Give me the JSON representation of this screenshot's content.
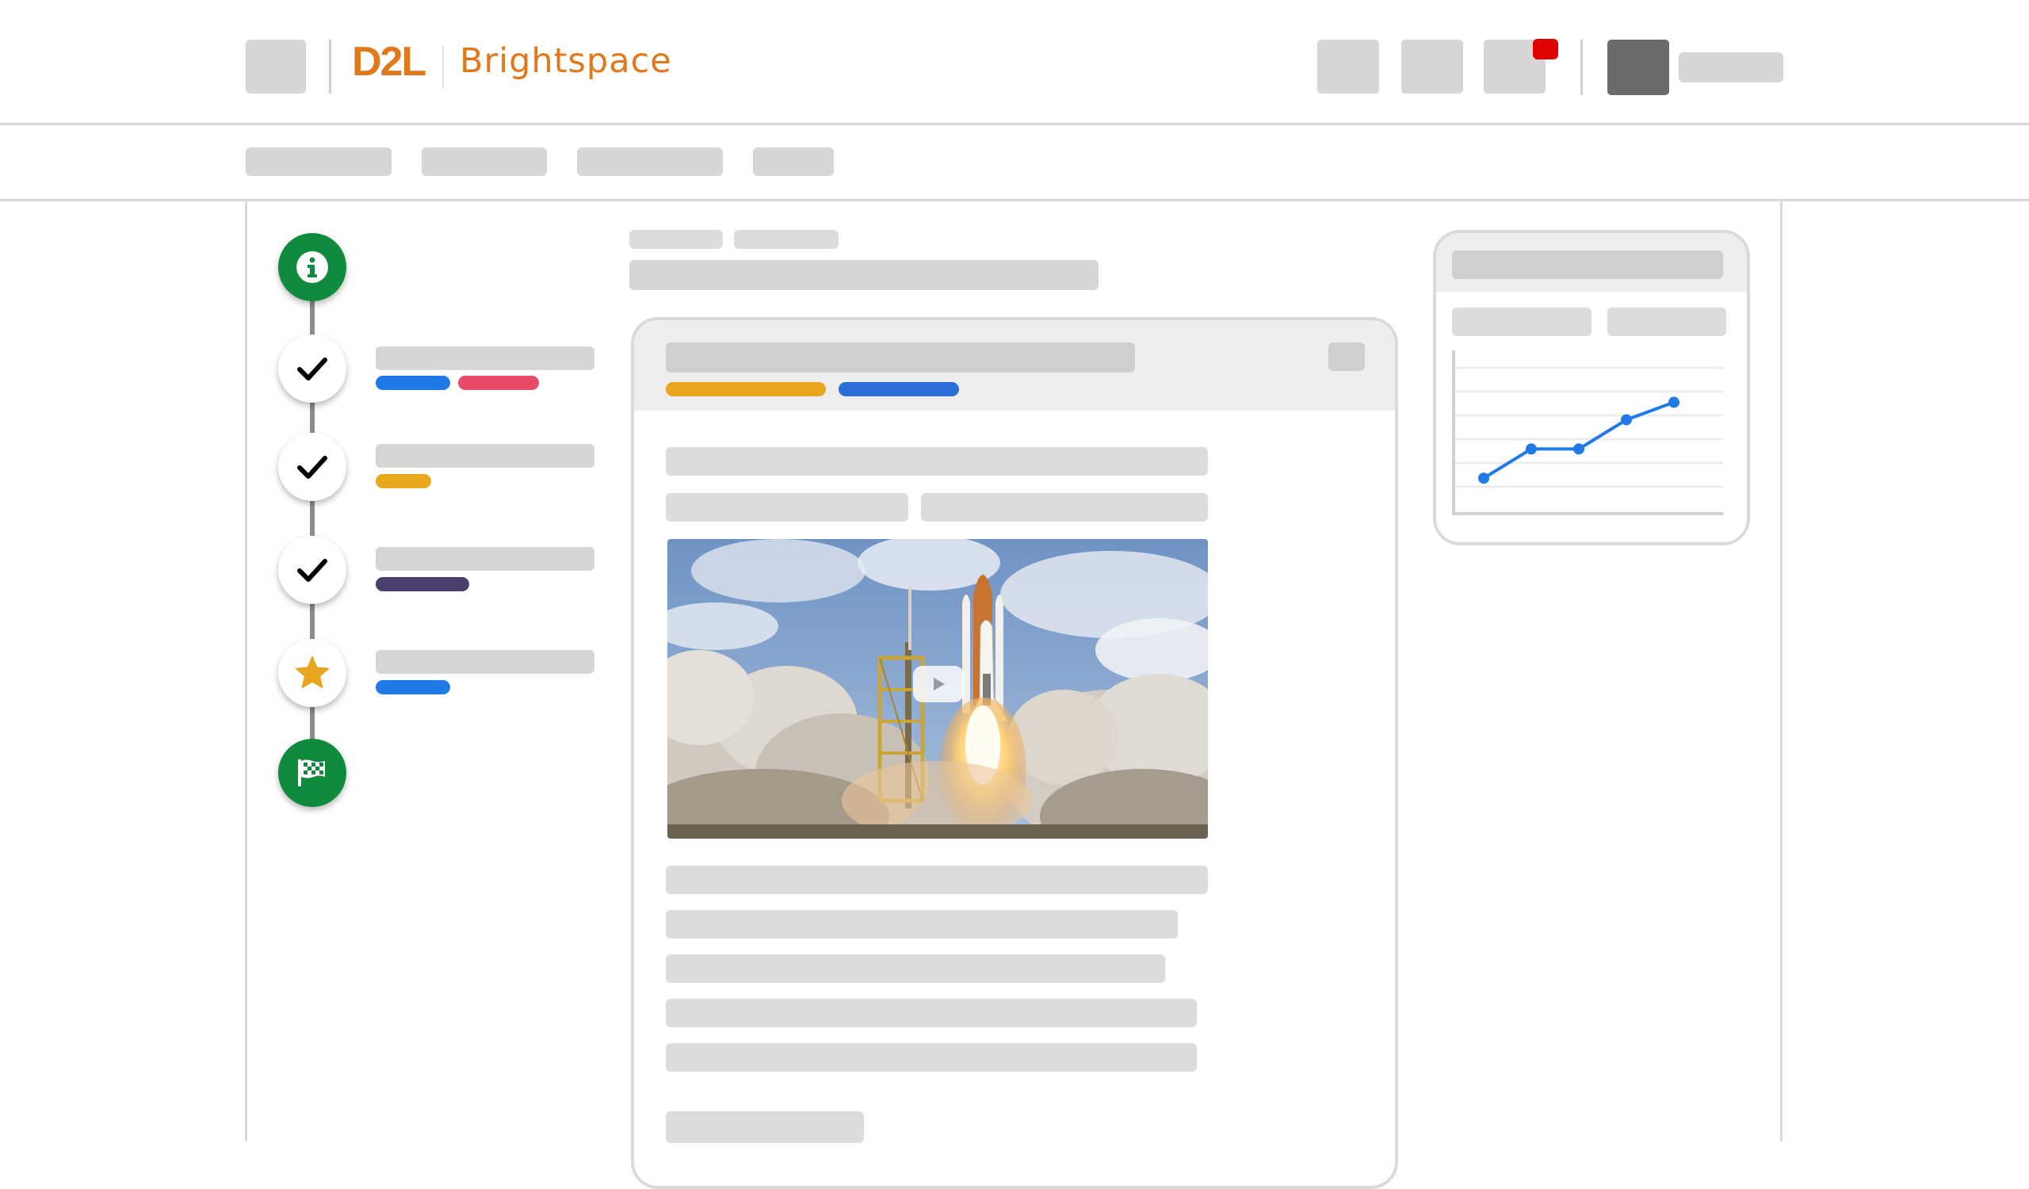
{
  "header": {
    "logo_primary": "D2L",
    "logo_secondary": "Brightspace",
    "notification_color": "#e00000",
    "brand_color": "#e0791b"
  },
  "timeline": {
    "nodes": [
      {
        "icon": "info-icon",
        "style": "green"
      },
      {
        "icon": "check-icon",
        "style": "complete"
      },
      {
        "icon": "check-icon",
        "style": "complete"
      },
      {
        "icon": "check-icon",
        "style": "complete"
      },
      {
        "icon": "star-icon",
        "style": "current"
      },
      {
        "icon": "checkered-flag-icon",
        "style": "green"
      }
    ],
    "tag_colors": [
      "#1f7ae8",
      "#e84a6a",
      "#e8a81e",
      "#4a3f6e",
      "#1f7ae8"
    ]
  },
  "content_card": {
    "tag_colors": [
      "#eaa51f",
      "#2a6fd8"
    ],
    "video_control": "play-icon"
  },
  "chart_data": {
    "type": "line",
    "x": [
      1,
      2,
      3,
      4,
      5
    ],
    "y": [
      1,
      2,
      2,
      3,
      3.6
    ],
    "ylim": [
      0,
      5
    ],
    "color": "#1f7ae8",
    "grid": true
  }
}
